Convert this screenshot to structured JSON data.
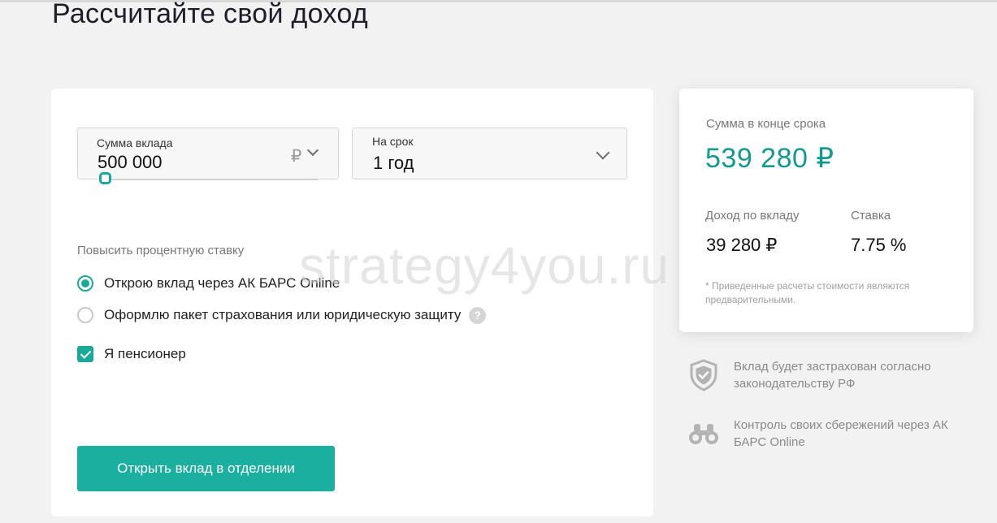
{
  "page": {
    "title": "Рассчитайте свой доход"
  },
  "form": {
    "sum_label": "Сумма вклада",
    "sum_value": "500 000",
    "currency_symbol": "₽",
    "term_label": "На срок",
    "term_value": "1 год",
    "slider_position": 0.02,
    "raise_rate_label": "Повысить процентную ставку",
    "options": [
      {
        "label": "Открою вклад через АК БАРС Online",
        "type": "radio",
        "checked": true
      },
      {
        "label": "Оформлю пакет страхования или юридическую защиту",
        "type": "radio",
        "checked": false,
        "help": "?"
      },
      {
        "label": "Я пенсионер",
        "type": "checkbox",
        "checked": true
      }
    ],
    "submit_label": "Открыть вклад в отделении"
  },
  "result": {
    "total_label": "Сумма в конце срока",
    "total_value": "539 280 ₽",
    "income_label": "Доход по вкладу",
    "income_value": "39 280 ₽",
    "rate_label": "Ставка",
    "rate_value": "7.75 %",
    "note": "* Приведенные расчеты стоимости являются предварительными."
  },
  "features": [
    {
      "icon": "shield-check-icon",
      "text": "Вклад будет застрахован согласно законодательству РФ"
    },
    {
      "icon": "binoculars-icon",
      "text": "Контроль своих сбережений через АК БАРС Online"
    }
  ],
  "watermark": "strategy4you.ru",
  "colors": {
    "accent": "#1aaf9e",
    "accent_dark": "#139a8e",
    "background": "#f2f2f2"
  }
}
